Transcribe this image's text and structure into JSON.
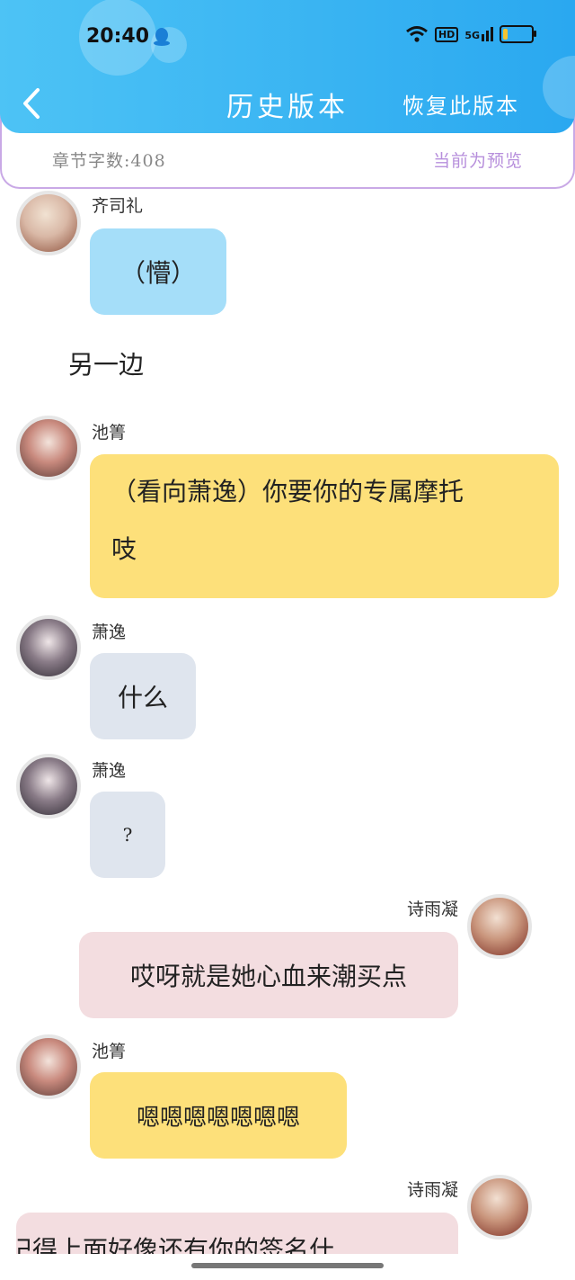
{
  "status_bar": {
    "time": "20:40",
    "network_label": "5G",
    "hd_label": "HD",
    "battery_level": 0.15,
    "icons": [
      "qq-penguin-icon",
      "wifi-icon",
      "signal-icon",
      "battery-icon"
    ]
  },
  "header": {
    "back_icon": "chevron-left-icon",
    "title": "历史版本",
    "restore_label": "恢复此版本"
  },
  "info_bar": {
    "word_count": "章节字数:408",
    "preview_label": "当前为预览"
  },
  "messages": [
    {
      "name": "齐司礼",
      "text": "（懵）",
      "color": "#a5def9",
      "side": "left"
    },
    {
      "narration": "另一边"
    },
    {
      "name": "池箐",
      "text_line1": "（看向萧逸）你要你的专属摩托",
      "text_line2": "吱",
      "color": "#fde07a",
      "side": "left"
    },
    {
      "name": "萧逸",
      "text": "什么",
      "color": "#dfe5ee",
      "side": "left"
    },
    {
      "name": "萧逸",
      "text": "?",
      "color": "#dfe5ee",
      "side": "left"
    },
    {
      "name": "诗雨凝",
      "text": "哎呀就是她心血来潮买点",
      "color": "#f3dde0",
      "side": "right"
    },
    {
      "name": "池箐",
      "text": "嗯嗯嗯嗯嗯嗯嗯",
      "color": "#fde07a",
      "side": "left"
    },
    {
      "name": "诗雨凝",
      "text": "记得上面好像还有你的签名什",
      "color": "#f3dde0",
      "side": "right"
    }
  ],
  "colors": {
    "header_gradient_start": "#4dc3f5",
    "header_gradient_end": "#2aa8f0",
    "info_border": "#c9a9e6",
    "preview_text": "#b78fdc"
  }
}
